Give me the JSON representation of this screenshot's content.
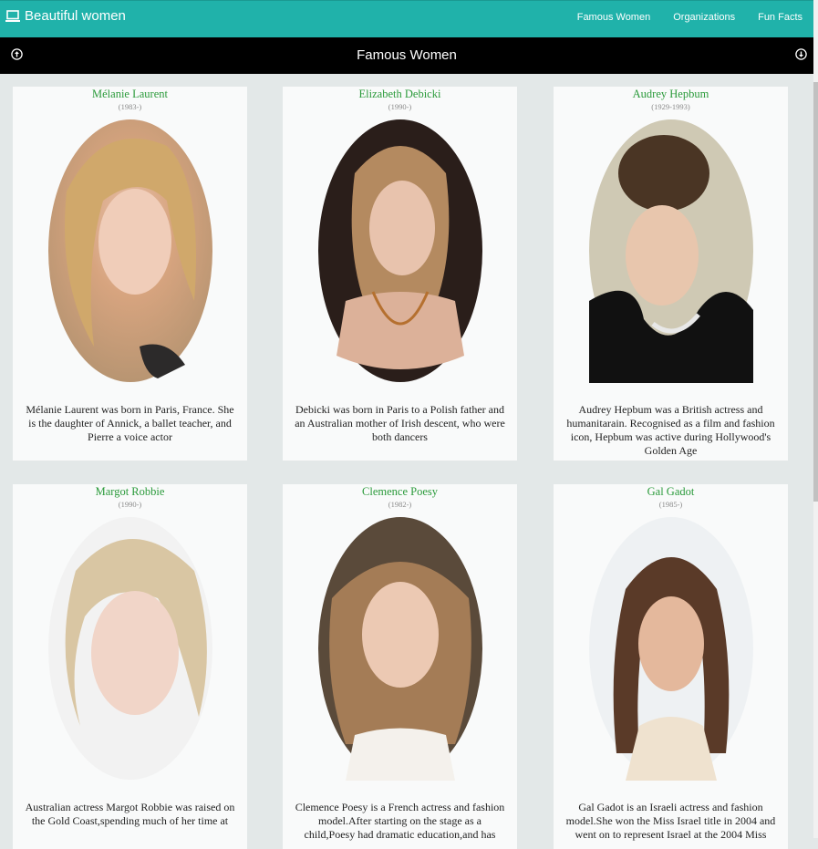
{
  "brand": {
    "title": "Beautiful women",
    "icon": "laptop-icon"
  },
  "nav": {
    "items": [
      {
        "label": "Famous Women"
      },
      {
        "label": "Organizations"
      },
      {
        "label": "Fun Facts"
      }
    ]
  },
  "subheader": {
    "title": "Famous Women",
    "left_icon": "arrow-up-circle-icon",
    "right_icon": "arrow-down-circle-icon"
  },
  "colors": {
    "topbar": "#20b2aa",
    "subbar": "#000000",
    "name": "#2a9a3a",
    "background": "#e3e8e8",
    "card": "#f9fafa"
  },
  "cards": [
    {
      "name": "Mélanie Laurent",
      "years": "(1983-)",
      "bio": "Mélanie Laurent was born in Paris, France. She is the daughter of Annick, a ballet teacher, and Pierre a voice actor"
    },
    {
      "name": "Elizabeth Debicki",
      "years": "(1990-)",
      "bio": "Debicki was born in Paris to a Polish father and an Australian mother of Irish descent, who were both dancers"
    },
    {
      "name": "Audrey Hepbum",
      "years": "(1929-1993)",
      "bio": "Audrey Hepbum was a British actress and humanitarain. Recognised as a film and fashion icon, Hepbum was active during Hollywood's Golden Age"
    },
    {
      "name": "Margot Robbie",
      "years": "(1990-)",
      "bio": "Australian actress Margot Robbie was raised on the Gold Coast,spending much of her time at"
    },
    {
      "name": "Clemence Poesy",
      "years": "(1982-)",
      "bio": "Clemence Poesy is a French actress and fashion model.After starting on the stage as a child,Poesy had dramatic education,and has"
    },
    {
      "name": "Gal Gadot",
      "years": "(1985-)",
      "bio": "Gal Gadot is an Israeli actress and fashion model.She won the Miss Israel title in 2004 and went on to represent Israel at the 2004 Miss"
    }
  ]
}
